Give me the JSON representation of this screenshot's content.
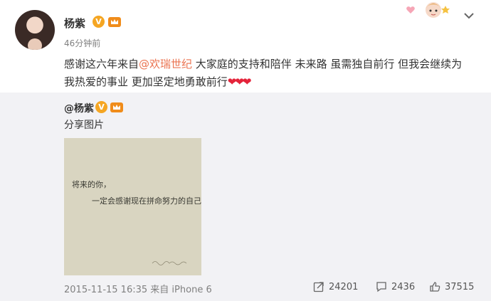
{
  "post": {
    "username": "杨紫",
    "verified_badge": "V",
    "timestamp": "46分钟前",
    "content": {
      "text_before": "感谢这六年来自",
      "mention": "@欢瑞世纪",
      "text_after": " 大家庭的支持和陪伴 未来路 虽需独自前行 但我会继续为我热爱的事业 更加坚定地勇敢前行",
      "hearts": "❤❤❤"
    },
    "icons": {
      "avatar": "avatar-portrait",
      "badge": "verified-v-icon",
      "member": "crown-icon",
      "decoration": "sticker-decoration",
      "menu": "chevron-down-icon"
    }
  },
  "repost": {
    "username": "@杨紫",
    "verified_badge": "V",
    "text": "分享图片",
    "image": {
      "line1": "将来的你，",
      "line2": "一定会感谢现在拼命努力的自己"
    }
  },
  "meta": {
    "datetime": "2015-11-15 16:35",
    "source": "来自 iPhone 6"
  },
  "actions": {
    "forward_count": "24201",
    "comment_count": "2436",
    "like_count": "37515"
  },
  "colors": {
    "mention": "#eb7350",
    "repost_bg": "#f2f2f5",
    "heart": "#e4233a",
    "badge": "#f5a623"
  }
}
